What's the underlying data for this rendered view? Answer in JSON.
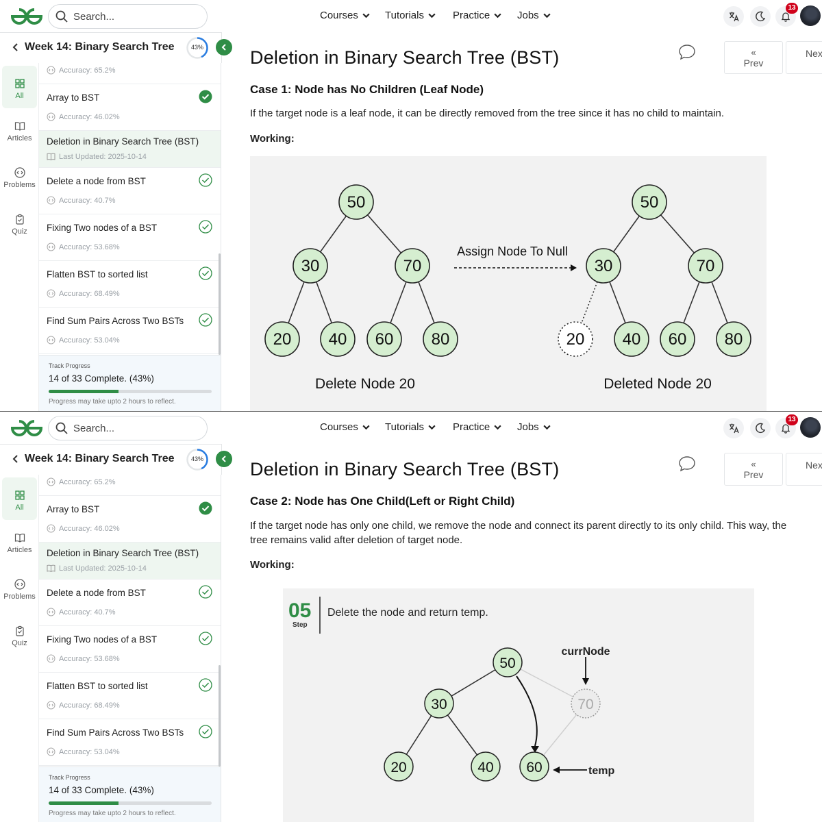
{
  "header": {
    "search_placeholder": "Search...",
    "nav": [
      "Courses",
      "Tutorials",
      "Practice",
      "Jobs"
    ],
    "notification_count": "13",
    "icons": [
      "search-icon",
      "translate-icon",
      "moon-icon",
      "bell-icon",
      "avatar"
    ]
  },
  "sidebar": {
    "week_title": "Week 14: Binary Search Tree",
    "progress_ring": "43%",
    "rail": [
      {
        "label": "All",
        "icon": "grid-icon",
        "active": true
      },
      {
        "label": "Articles",
        "icon": "book-icon",
        "active": false
      },
      {
        "label": "Problems",
        "icon": "code-icon",
        "active": false
      },
      {
        "label": "Quiz",
        "icon": "clipboard-icon",
        "active": false
      }
    ],
    "top_partial_meta": "Accuracy: 65.2%",
    "items": [
      {
        "title": "Array to BST",
        "meta": "Accuracy: 46.02%",
        "status": "solved"
      },
      {
        "title": "Deletion in Binary Search Tree (BST)",
        "meta": "Last Updated: 2025-10-14",
        "status": "current"
      },
      {
        "title": "Delete a node from BST",
        "meta": "Accuracy: 40.7%",
        "status": "pending"
      },
      {
        "title": "Fixing Two nodes of a BST",
        "meta": "Accuracy: 53.68%",
        "status": "pending"
      },
      {
        "title": "Flatten BST to sorted list",
        "meta": "Accuracy: 68.49%",
        "status": "pending"
      },
      {
        "title": "Find Sum Pairs Across Two BSTs",
        "meta": "Accuracy: 53.04%",
        "status": "pending"
      }
    ],
    "track": {
      "label": "Track Progress",
      "complete_text": "14 of 33 Complete. (43%)",
      "progress": 0.43,
      "note": "Progress may take upto 2 hours to reflect."
    }
  },
  "panes": [
    {
      "title": "Deletion in Binary Search Tree (BST)",
      "prev_label": "Prev",
      "next_label": "Nex",
      "heading": "Case 1: Node has No Children (Leaf Node)",
      "paragraph": "If the target node is a leaf node, it can be directly removed from the tree since it has no child to maintain.",
      "working_label": "Working:",
      "figure": {
        "left_nodes": [
          "50",
          "30",
          "70",
          "20",
          "40",
          "60",
          "80"
        ],
        "right_nodes": [
          "50",
          "30",
          "70",
          "20",
          "40",
          "60",
          "80"
        ],
        "arrow_label": "Assign Node To Null",
        "left_caption": "Delete Node 20",
        "right_caption": "Deleted Node 20"
      }
    },
    {
      "title": "Deletion in Binary Search Tree (BST)",
      "prev_label": "Prev",
      "next_label": "Nex",
      "heading": "Case 2: Node has One Child(Left or Right Child)",
      "paragraph": "If the target node has only one child, we remove the node and connect its parent directly to its only child. This way, the tree remains valid after deletion of target node.",
      "working_label": "Working:",
      "figure": {
        "step_number": "05",
        "step_label": "Step",
        "step_text": "Delete the node  and return temp.",
        "nodes": [
          "50",
          "30",
          "70",
          "20",
          "40",
          "60"
        ],
        "curr_label": "currNode",
        "temp_label": "temp"
      }
    }
  ],
  "colors": {
    "brand_green": "#2f8d46",
    "node_fill": "#d5eed0",
    "node_stroke": "#222222",
    "badge_red": "#d0021b"
  }
}
